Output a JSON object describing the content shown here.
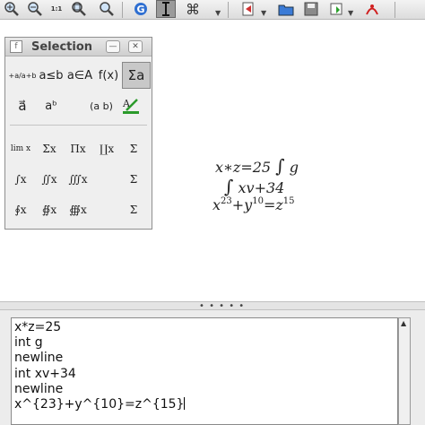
{
  "toolbar": {
    "icons": [
      "zoom-in-icon",
      "zoom-out-icon",
      "zoom-100-icon",
      "zoom-fit-icon",
      "update-icon",
      "cursor-icon",
      "symbols-icon",
      "export-icon",
      "open-icon",
      "save-icon",
      "insert-icon",
      "pdf-icon"
    ],
    "zoom_100_label": "1:1",
    "symbols_glyph": "⌘"
  },
  "selection_window": {
    "title": "Selection",
    "categories_row1": [
      "+a/a+b",
      "a≤b",
      "a∈A",
      "f(x)",
      "Σa"
    ],
    "categories_row2": [
      "a⃗",
      "aᵇ",
      "(a b)",
      "attrs"
    ],
    "symbols": {
      "row1": [
        "lim x",
        "Σx",
        "Πx",
        "∐x",
        "Σ"
      ],
      "row2": [
        "∫x",
        "∬x",
        "∭x",
        "Σ"
      ],
      "row3": [
        "∮x",
        "∯x",
        "∰x",
        "Σ"
      ]
    }
  },
  "formula": {
    "line1_left": "x∗z=25",
    "line1_int": "∫",
    "line1_right": "g",
    "line2_int": "∫",
    "line2_right": "xv+34",
    "line3_x": "x",
    "line3_exp1": "23",
    "line3_plus": "+",
    "line3_y": "y",
    "line3_exp2": "10",
    "line3_eq": "=",
    "line3_z": "z",
    "line3_exp3": "15"
  },
  "splitter": {
    "grip": "• • • • •"
  },
  "command": {
    "lines": [
      "x*z=25",
      "int g",
      "newline",
      "int xv+34",
      "newline",
      "x^{23}+y^{10}=z^{15}"
    ]
  }
}
